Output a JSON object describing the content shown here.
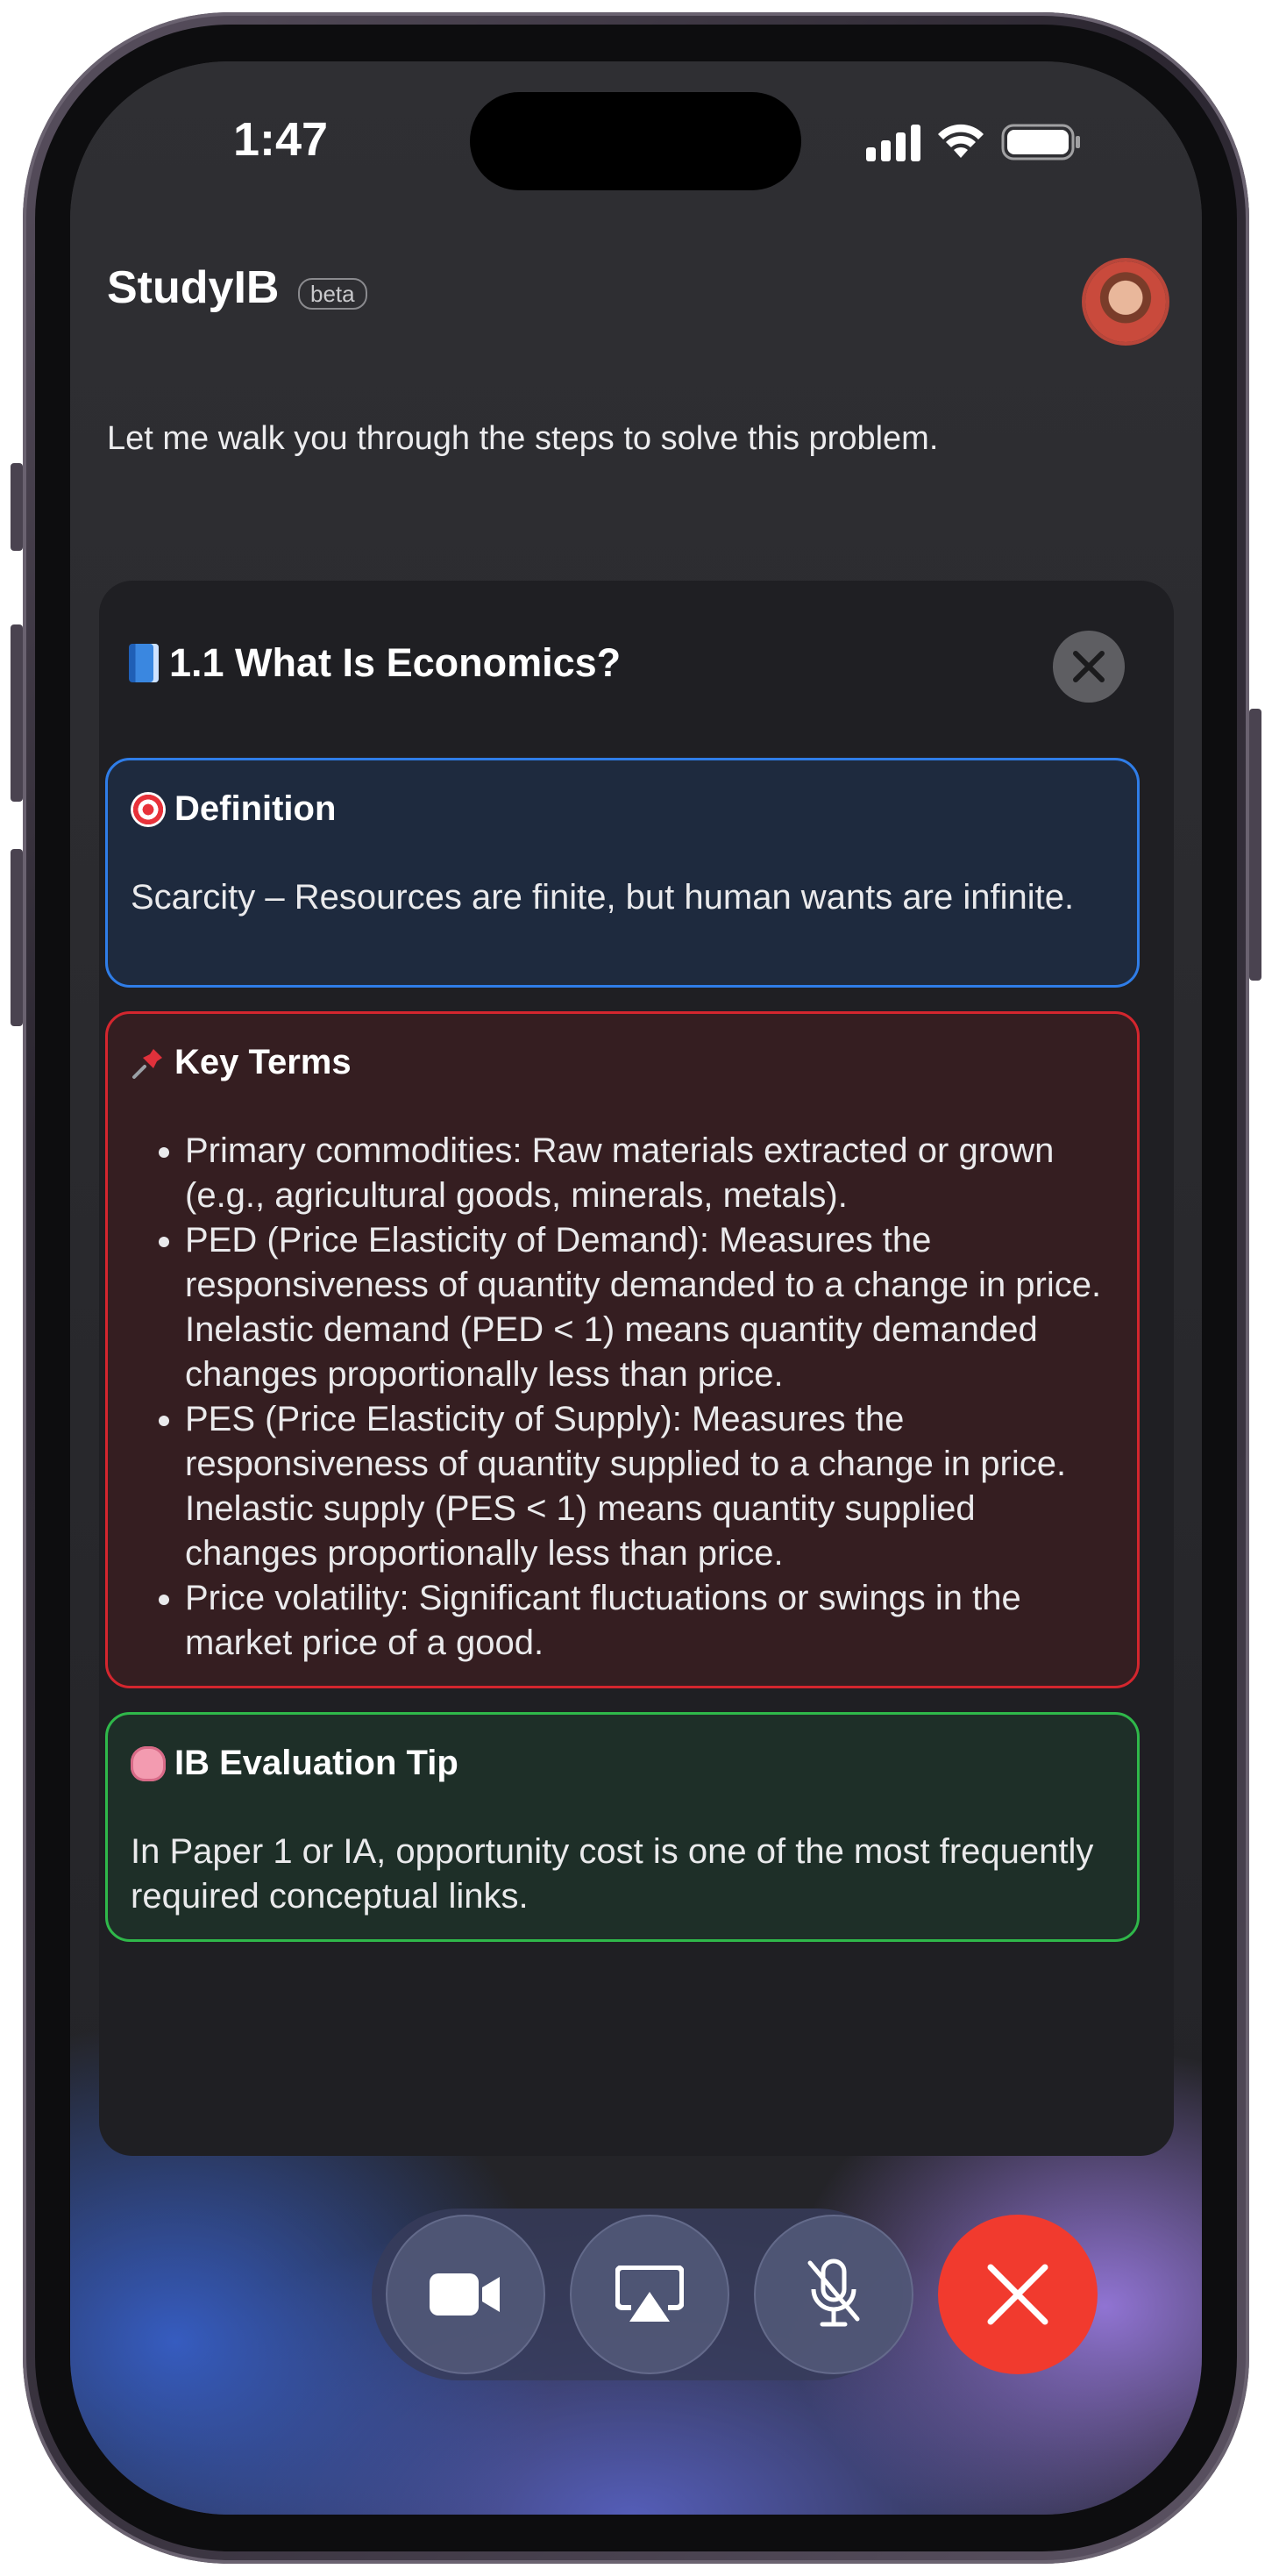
{
  "status_bar": {
    "time": "1:47"
  },
  "header": {
    "app_name": "StudyIB",
    "badge": "beta",
    "avatar": "user-avatar"
  },
  "message": "Let me walk you through the steps to solve this problem.",
  "panel": {
    "title": "1.1 What Is Economics?",
    "title_icon": "book-icon",
    "close_icon": "close-icon",
    "cards": {
      "definition": {
        "icon": "target-icon",
        "heading": "Definition",
        "body": "Scarcity – Resources are finite, but human wants are infinite.",
        "color": "#2f7de8"
      },
      "key_terms": {
        "icon": "pin-icon",
        "heading": "Key Terms",
        "color": "#d4262e",
        "items": [
          "Primary commodities: Raw materials extracted or grown (e.g., agricultural goods, minerals, metals).",
          "PED (Price Elasticity of Demand): Measures the responsiveness of quantity demanded to a change in price. Inelastic demand (PED < 1) means quantity demanded changes proportionally less than price.",
          "PES (Price Elasticity of Supply): Measures the responsiveness of quantity supplied to a change in price. Inelastic supply (PES < 1) means quantity supplied changes proportionally less than price.",
          "Price volatility: Significant fluctuations or swings in the market price of a good."
        ]
      },
      "tip": {
        "icon": "brain-icon",
        "heading": "IB Evaluation Tip",
        "body": "In Paper 1 or IA, opportunity cost is one of the most frequently required conceptual links.",
        "color": "#2fb84a"
      }
    }
  },
  "call_controls": {
    "buttons": [
      "video-camera-icon",
      "airplay-icon",
      "microphone-muted-icon",
      "end-call-icon"
    ],
    "end_color": "#f13a2e"
  }
}
